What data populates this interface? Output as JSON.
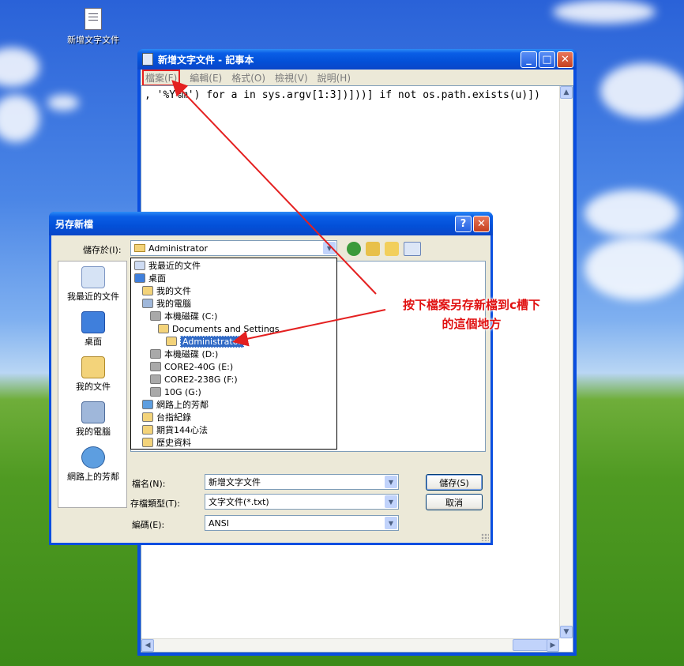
{
  "desktop": {
    "icon_label": "新增文字文件"
  },
  "notepad": {
    "title": "新增文字文件 - 記事本",
    "menu": [
      "檔案(F)",
      "編輯(E)",
      "格式(O)",
      "檢視(V)",
      "說明(H)"
    ],
    "content": ", '%Y%m') for a in sys.argv[1:3])]))] if not os.path.exists(u)])"
  },
  "dialog": {
    "title": "另存新檔",
    "save_in_label": "儲存於(I):",
    "save_in_value": "Administrator",
    "places": [
      "我最近的文件",
      "桌面",
      "我的文件",
      "我的電腦",
      "網路上的芳鄰"
    ],
    "tree": [
      {
        "label": "我最近的文件",
        "level": 0,
        "icon": "recent-icon"
      },
      {
        "label": "桌面",
        "level": 0,
        "icon": "desktop-icon"
      },
      {
        "label": "我的文件",
        "level": 1,
        "icon": "documents-icon"
      },
      {
        "label": "我的電腦",
        "level": 1,
        "icon": "computer-icon"
      },
      {
        "label": "本機磁碟 (C:)",
        "level": 2,
        "icon": "drive-icon"
      },
      {
        "label": "Documents and Settings",
        "level": 3,
        "icon": "folder-icon"
      },
      {
        "label": "Administrator",
        "level": 4,
        "icon": "folder-open-icon",
        "selected": true
      },
      {
        "label": "本機磁碟 (D:)",
        "level": 2,
        "icon": "drive-icon"
      },
      {
        "label": "CORE2-40G (E:)",
        "level": 2,
        "icon": "drive-icon"
      },
      {
        "label": "CORE2-238G (F:)",
        "level": 2,
        "icon": "drive-icon"
      },
      {
        "label": "10G (G:)",
        "level": 2,
        "icon": "drive-icon"
      },
      {
        "label": "網路上的芳鄰",
        "level": 1,
        "icon": "network-icon"
      },
      {
        "label": "台指紀錄",
        "level": 1,
        "icon": "folder-icon"
      },
      {
        "label": "期貨144心法",
        "level": 1,
        "icon": "folder-icon"
      },
      {
        "label": "歷史資料",
        "level": 1,
        "icon": "folder-icon"
      }
    ],
    "filename_label": "檔名(N):",
    "filename_value": "新增文字文件",
    "filetype_label": "存檔類型(T):",
    "filetype_value": "文字文件(*.txt)",
    "encoding_label": "編碼(E):",
    "encoding_value": "ANSI",
    "save_button": "儲存(S)",
    "cancel_button": "取消",
    "help_button": "?",
    "close_button": "✕"
  },
  "annotation": {
    "line1": "按下檔案另存新檔到c槽下",
    "line2": "的這個地方",
    "color": "#e01010"
  }
}
